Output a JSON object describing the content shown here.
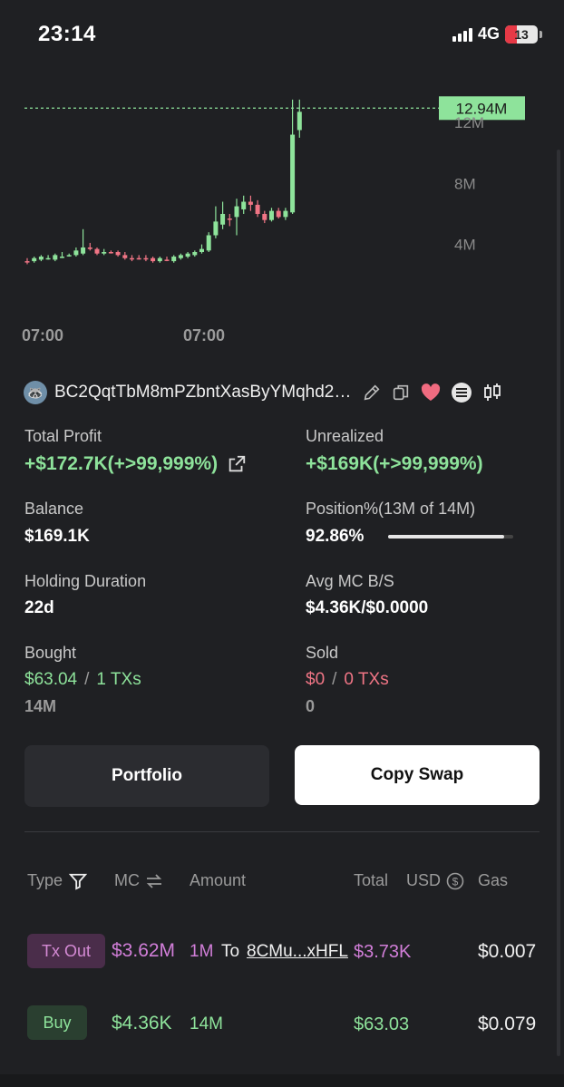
{
  "status": {
    "time": "23:14",
    "network": "4G",
    "battery": "13"
  },
  "chart_data": {
    "type": "candlestick",
    "title": "",
    "price_tag": "12.94M",
    "y_ticks": [
      "12M",
      "8M",
      "4M"
    ],
    "x_ticks": [
      "07:00",
      "07:00"
    ],
    "candles": [
      {
        "o": 2.9,
        "c": 2.9,
        "h": 3.1,
        "l": 2.7,
        "up": false
      },
      {
        "o": 2.9,
        "c": 3.1,
        "h": 3.2,
        "l": 2.8,
        "up": true
      },
      {
        "o": 3.0,
        "c": 3.2,
        "h": 3.3,
        "l": 2.9,
        "up": true
      },
      {
        "o": 3.1,
        "c": 3.1,
        "h": 3.3,
        "l": 3.0,
        "up": true
      },
      {
        "o": 3.0,
        "c": 3.3,
        "h": 3.4,
        "l": 2.9,
        "up": true
      },
      {
        "o": 3.2,
        "c": 3.2,
        "h": 3.5,
        "l": 3.1,
        "up": true
      },
      {
        "o": 3.3,
        "c": 3.3,
        "h": 3.4,
        "l": 3.2,
        "up": true
      },
      {
        "o": 3.3,
        "c": 3.6,
        "h": 3.8,
        "l": 3.2,
        "up": true
      },
      {
        "o": 3.4,
        "c": 3.8,
        "h": 5.0,
        "l": 3.3,
        "up": true
      },
      {
        "o": 3.8,
        "c": 3.7,
        "h": 4.1,
        "l": 3.6,
        "up": false
      },
      {
        "o": 3.7,
        "c": 3.4,
        "h": 3.8,
        "l": 3.3,
        "up": false
      },
      {
        "o": 3.4,
        "c": 3.5,
        "h": 3.7,
        "l": 3.3,
        "up": true
      },
      {
        "o": 3.5,
        "c": 3.5,
        "h": 3.6,
        "l": 3.4,
        "up": false
      },
      {
        "o": 3.5,
        "c": 3.3,
        "h": 3.6,
        "l": 3.2,
        "up": false
      },
      {
        "o": 3.3,
        "c": 3.1,
        "h": 3.5,
        "l": 3.0,
        "up": false
      },
      {
        "o": 3.1,
        "c": 3.1,
        "h": 3.3,
        "l": 2.9,
        "up": false
      },
      {
        "o": 3.1,
        "c": 3.1,
        "h": 3.3,
        "l": 3.0,
        "up": false
      },
      {
        "o": 3.1,
        "c": 3.1,
        "h": 3.3,
        "l": 2.9,
        "up": false
      },
      {
        "o": 3.1,
        "c": 2.9,
        "h": 3.2,
        "l": 2.8,
        "up": false
      },
      {
        "o": 2.9,
        "c": 3.1,
        "h": 3.2,
        "l": 2.8,
        "up": true
      },
      {
        "o": 3.0,
        "c": 3.0,
        "h": 3.2,
        "l": 2.9,
        "up": false
      },
      {
        "o": 2.9,
        "c": 3.2,
        "h": 3.3,
        "l": 2.8,
        "up": true
      },
      {
        "o": 3.1,
        "c": 3.3,
        "h": 3.4,
        "l": 3.0,
        "up": true
      },
      {
        "o": 3.2,
        "c": 3.4,
        "h": 3.5,
        "l": 3.1,
        "up": true
      },
      {
        "o": 3.3,
        "c": 3.5,
        "h": 3.6,
        "l": 3.2,
        "up": true
      },
      {
        "o": 3.5,
        "c": 3.7,
        "h": 4.0,
        "l": 3.4,
        "up": true
      },
      {
        "o": 3.6,
        "c": 4.6,
        "h": 4.8,
        "l": 3.5,
        "up": true
      },
      {
        "o": 4.6,
        "c": 5.5,
        "h": 6.5,
        "l": 4.4,
        "up": true
      },
      {
        "o": 5.3,
        "c": 6.0,
        "h": 6.8,
        "l": 5.0,
        "up": true
      },
      {
        "o": 5.7,
        "c": 5.7,
        "h": 6.0,
        "l": 5.2,
        "up": false
      },
      {
        "o": 5.8,
        "c": 6.5,
        "h": 7.0,
        "l": 4.6,
        "up": true
      },
      {
        "o": 6.3,
        "c": 6.8,
        "h": 7.2,
        "l": 6.0,
        "up": true
      },
      {
        "o": 6.8,
        "c": 6.6,
        "h": 7.2,
        "l": 6.2,
        "up": false
      },
      {
        "o": 6.6,
        "c": 6.0,
        "h": 6.9,
        "l": 5.8,
        "up": false
      },
      {
        "o": 6.0,
        "c": 5.6,
        "h": 6.2,
        "l": 5.4,
        "up": false
      },
      {
        "o": 5.6,
        "c": 6.2,
        "h": 6.4,
        "l": 5.5,
        "up": true
      },
      {
        "o": 6.2,
        "c": 5.8,
        "h": 6.4,
        "l": 5.7,
        "up": false
      },
      {
        "o": 5.8,
        "c": 6.2,
        "h": 6.4,
        "l": 5.6,
        "up": true
      },
      {
        "o": 6.1,
        "c": 11.2,
        "h": 13.5,
        "l": 6.0,
        "up": true
      },
      {
        "o": 11.5,
        "c": 12.7,
        "h": 13.5,
        "l": 11.0,
        "up": true
      }
    ],
    "last": 12.94,
    "y_range": [
      1.3,
      14.8
    ]
  },
  "wallet": {
    "address": "BC2QqtTbM8mPZbntXasByYMqhd2…"
  },
  "stats": {
    "total_profit_label": "Total Profit",
    "total_profit_value": "+$172.7K(+>99,999%)",
    "unrealized_label": "Unrealized",
    "unrealized_value": "+$169K(+>99,999%)",
    "balance_label": "Balance",
    "balance_value": "$169.1K",
    "position_label": "Position%(13M of 14M)",
    "position_value": "92.86%",
    "position_fraction": 0.9286,
    "holding_label": "Holding Duration",
    "holding_value": "22d",
    "avgmc_label": "Avg MC B/S",
    "avgmc_value": "$4.36K/$0.0000",
    "bought_label": "Bought",
    "bought_usd": "$63.04",
    "bought_sep": "/",
    "bought_txs": "1 TXs",
    "bought_amount": "14M",
    "sold_label": "Sold",
    "sold_usd": "$0",
    "sold_sep": "/",
    "sold_txs": "0 TXs",
    "sold_amount": "0"
  },
  "buttons": {
    "portfolio": "Portfolio",
    "copy_swap": "Copy Swap"
  },
  "table": {
    "headers": {
      "type": "Type",
      "mc": "MC",
      "amount": "Amount",
      "total": "Total",
      "usd": "USD",
      "gas": "Gas"
    },
    "rows": [
      {
        "type": "Tx Out",
        "mc": "$3.62M",
        "amount": "1M",
        "to": "To",
        "addr": "8CMu...xHFL",
        "total": "$3.73K",
        "gas": "$0.007"
      },
      {
        "type": "Buy",
        "mc": "$4.36K",
        "amount": "14M",
        "total": "$63.03",
        "gas": "$0.079"
      }
    ]
  }
}
